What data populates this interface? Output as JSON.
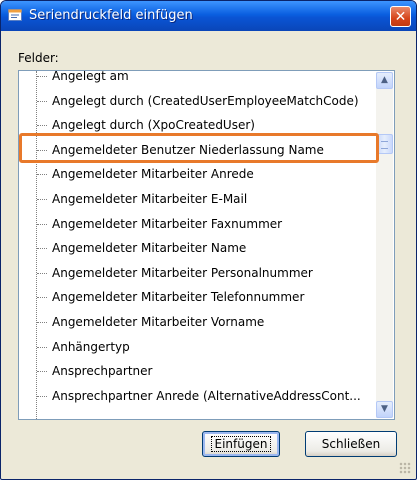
{
  "window": {
    "title": "Seriendruckfeld einfügen",
    "close_glyph": "✕"
  },
  "dialog": {
    "fields_label": "Felder:",
    "selected_index": 3,
    "items": [
      "Angelegt am",
      "Angelegt durch (CreatedUserEmployeeMatchCode)",
      "Angelegt durch (XpoCreatedUser)",
      "Angemeldeter Benutzer Niederlassung Name",
      "Angemeldeter Mitarbeiter Anrede",
      "Angemeldeter Mitarbeiter E-Mail",
      "Angemeldeter Mitarbeiter Faxnummer",
      "Angemeldeter Mitarbeiter Name",
      "Angemeldeter Mitarbeiter Personalnummer",
      "Angemeldeter Mitarbeiter Telefonnummer",
      "Angemeldeter Mitarbeiter Vorname",
      "Anhängertyp",
      "Ansprechpartner",
      "Ansprechpartner Anrede (AlternativeAddressCont..."
    ],
    "scroll_up_glyph": "▲",
    "scroll_down_glyph": "▼",
    "ok_label": "Einfügen",
    "cancel_label": "Schließen"
  },
  "colors": {
    "highlight_border": "#e8792a",
    "title_bar": "#0a54d4"
  }
}
